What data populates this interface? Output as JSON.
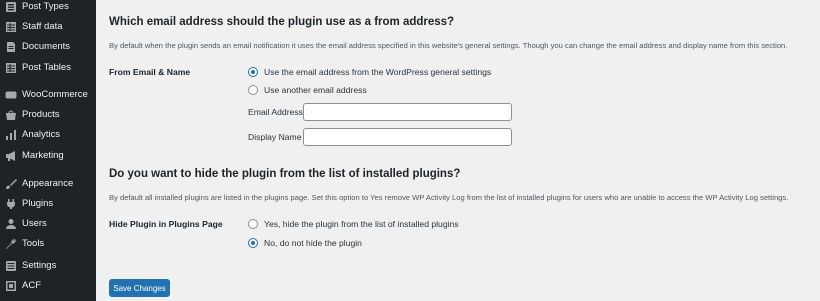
{
  "sidebar": {
    "items": [
      {
        "label": "Post Types",
        "icon": "post-types-icon"
      },
      {
        "label": "Staff data",
        "icon": "table-icon"
      },
      {
        "label": "Documents",
        "icon": "document-icon"
      },
      {
        "label": "Post Tables",
        "icon": "table-icon"
      },
      {
        "label": "WooCommerce",
        "icon": "woocommerce-icon"
      },
      {
        "label": "Products",
        "icon": "products-icon"
      },
      {
        "label": "Analytics",
        "icon": "bar-chart-icon"
      },
      {
        "label": "Marketing",
        "icon": "megaphone-icon"
      },
      {
        "label": "Appearance",
        "icon": "paintbrush-icon"
      },
      {
        "label": "Plugins",
        "icon": "plug-icon"
      },
      {
        "label": "Users",
        "icon": "user-icon"
      },
      {
        "label": "Tools",
        "icon": "wrench-icon"
      },
      {
        "label": "Settings",
        "icon": "settings-icon"
      },
      {
        "label": "ACF",
        "icon": "acf-icon"
      }
    ]
  },
  "email_section": {
    "heading": "Which email address should the plugin use as a from address?",
    "description": "By default when the plugin sends an email notification it uses the email address specified in this website's general settings. Though you can change the email address and display name from this section.",
    "row_label": "From Email & Name",
    "options": [
      {
        "label": "Use the email address from the WordPress general settings",
        "checked": true
      },
      {
        "label": "Use another email address",
        "checked": false
      }
    ],
    "email_address_label": "Email Address",
    "email_address_value": "",
    "display_name_label": "Display Name",
    "display_name_value": ""
  },
  "plugin_section": {
    "heading": "Do you want to hide the plugin from the list of installed plugins?",
    "description": "By default all installed plugins are listed in the plugins page. Set this option to Yes remove WP Activity Log from the list of installed plugins for users who are unable to access the WP Activity Log settings.",
    "row_label": "Hide Plugin in Plugins Page",
    "options": [
      {
        "label": "Yes, hide the plugin from the list of installed plugins",
        "checked": false
      },
      {
        "label": "No, do not hide the plugin",
        "checked": true
      }
    ]
  },
  "save_button_label": "Save Changes",
  "colors": {
    "sidebar_bg": "#1d2327",
    "accent": "#2271b1",
    "page_bg": "#f0f0f1"
  }
}
